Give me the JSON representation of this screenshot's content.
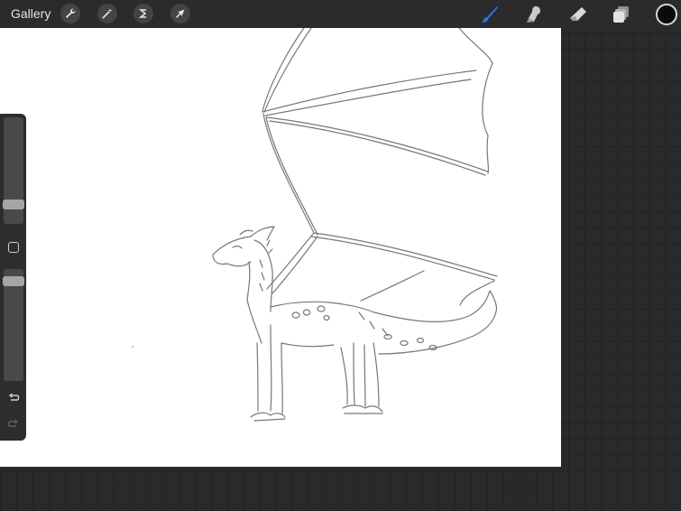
{
  "toolbar": {
    "gallery_label": "Gallery",
    "left_tools": [
      "wrench-icon",
      "magic-wand-icon",
      "selection-icon",
      "transform-arrow-icon"
    ],
    "right_tools": [
      "brush-icon",
      "smudge-icon",
      "eraser-icon",
      "layers-icon"
    ],
    "active_tool": "brush",
    "active_color": "#0a0a0a",
    "accent_color": "#1e7be6"
  },
  "sidebar": {
    "brush_size": 0.15,
    "opacity": 0.95
  },
  "canvas": {
    "background": "#ffffff",
    "subject": "dragon-sketch"
  }
}
